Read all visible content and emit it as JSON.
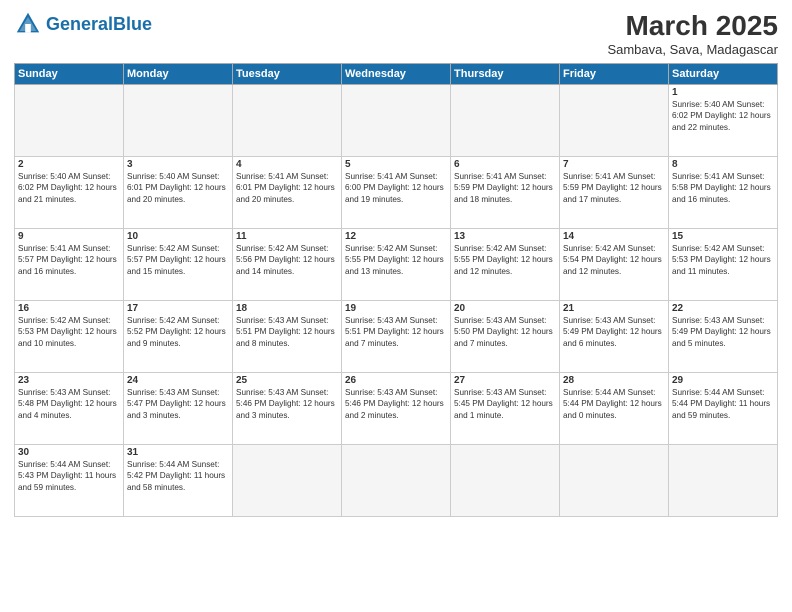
{
  "header": {
    "logo_general": "General",
    "logo_blue": "Blue",
    "month_title": "March 2025",
    "subtitle": "Sambava, Sava, Madagascar"
  },
  "weekdays": [
    "Sunday",
    "Monday",
    "Tuesday",
    "Wednesday",
    "Thursday",
    "Friday",
    "Saturday"
  ],
  "weeks": [
    [
      {
        "day": "",
        "info": ""
      },
      {
        "day": "",
        "info": ""
      },
      {
        "day": "",
        "info": ""
      },
      {
        "day": "",
        "info": ""
      },
      {
        "day": "",
        "info": ""
      },
      {
        "day": "",
        "info": ""
      },
      {
        "day": "1",
        "info": "Sunrise: 5:40 AM\nSunset: 6:02 PM\nDaylight: 12 hours and 22 minutes."
      }
    ],
    [
      {
        "day": "2",
        "info": "Sunrise: 5:40 AM\nSunset: 6:02 PM\nDaylight: 12 hours and 21 minutes."
      },
      {
        "day": "3",
        "info": "Sunrise: 5:40 AM\nSunset: 6:01 PM\nDaylight: 12 hours and 20 minutes."
      },
      {
        "day": "4",
        "info": "Sunrise: 5:41 AM\nSunset: 6:01 PM\nDaylight: 12 hours and 20 minutes."
      },
      {
        "day": "5",
        "info": "Sunrise: 5:41 AM\nSunset: 6:00 PM\nDaylight: 12 hours and 19 minutes."
      },
      {
        "day": "6",
        "info": "Sunrise: 5:41 AM\nSunset: 5:59 PM\nDaylight: 12 hours and 18 minutes."
      },
      {
        "day": "7",
        "info": "Sunrise: 5:41 AM\nSunset: 5:59 PM\nDaylight: 12 hours and 17 minutes."
      },
      {
        "day": "8",
        "info": "Sunrise: 5:41 AM\nSunset: 5:58 PM\nDaylight: 12 hours and 16 minutes."
      }
    ],
    [
      {
        "day": "9",
        "info": "Sunrise: 5:41 AM\nSunset: 5:57 PM\nDaylight: 12 hours and 16 minutes."
      },
      {
        "day": "10",
        "info": "Sunrise: 5:42 AM\nSunset: 5:57 PM\nDaylight: 12 hours and 15 minutes."
      },
      {
        "day": "11",
        "info": "Sunrise: 5:42 AM\nSunset: 5:56 PM\nDaylight: 12 hours and 14 minutes."
      },
      {
        "day": "12",
        "info": "Sunrise: 5:42 AM\nSunset: 5:55 PM\nDaylight: 12 hours and 13 minutes."
      },
      {
        "day": "13",
        "info": "Sunrise: 5:42 AM\nSunset: 5:55 PM\nDaylight: 12 hours and 12 minutes."
      },
      {
        "day": "14",
        "info": "Sunrise: 5:42 AM\nSunset: 5:54 PM\nDaylight: 12 hours and 12 minutes."
      },
      {
        "day": "15",
        "info": "Sunrise: 5:42 AM\nSunset: 5:53 PM\nDaylight: 12 hours and 11 minutes."
      }
    ],
    [
      {
        "day": "16",
        "info": "Sunrise: 5:42 AM\nSunset: 5:53 PM\nDaylight: 12 hours and 10 minutes."
      },
      {
        "day": "17",
        "info": "Sunrise: 5:42 AM\nSunset: 5:52 PM\nDaylight: 12 hours and 9 minutes."
      },
      {
        "day": "18",
        "info": "Sunrise: 5:43 AM\nSunset: 5:51 PM\nDaylight: 12 hours and 8 minutes."
      },
      {
        "day": "19",
        "info": "Sunrise: 5:43 AM\nSunset: 5:51 PM\nDaylight: 12 hours and 7 minutes."
      },
      {
        "day": "20",
        "info": "Sunrise: 5:43 AM\nSunset: 5:50 PM\nDaylight: 12 hours and 7 minutes."
      },
      {
        "day": "21",
        "info": "Sunrise: 5:43 AM\nSunset: 5:49 PM\nDaylight: 12 hours and 6 minutes."
      },
      {
        "day": "22",
        "info": "Sunrise: 5:43 AM\nSunset: 5:49 PM\nDaylight: 12 hours and 5 minutes."
      }
    ],
    [
      {
        "day": "23",
        "info": "Sunrise: 5:43 AM\nSunset: 5:48 PM\nDaylight: 12 hours and 4 minutes."
      },
      {
        "day": "24",
        "info": "Sunrise: 5:43 AM\nSunset: 5:47 PM\nDaylight: 12 hours and 3 minutes."
      },
      {
        "day": "25",
        "info": "Sunrise: 5:43 AM\nSunset: 5:46 PM\nDaylight: 12 hours and 3 minutes."
      },
      {
        "day": "26",
        "info": "Sunrise: 5:43 AM\nSunset: 5:46 PM\nDaylight: 12 hours and 2 minutes."
      },
      {
        "day": "27",
        "info": "Sunrise: 5:43 AM\nSunset: 5:45 PM\nDaylight: 12 hours and 1 minute."
      },
      {
        "day": "28",
        "info": "Sunrise: 5:44 AM\nSunset: 5:44 PM\nDaylight: 12 hours and 0 minutes."
      },
      {
        "day": "29",
        "info": "Sunrise: 5:44 AM\nSunset: 5:44 PM\nDaylight: 11 hours and 59 minutes."
      }
    ],
    [
      {
        "day": "30",
        "info": "Sunrise: 5:44 AM\nSunset: 5:43 PM\nDaylight: 11 hours and 59 minutes."
      },
      {
        "day": "31",
        "info": "Sunrise: 5:44 AM\nSunset: 5:42 PM\nDaylight: 11 hours and 58 minutes."
      },
      {
        "day": "",
        "info": ""
      },
      {
        "day": "",
        "info": ""
      },
      {
        "day": "",
        "info": ""
      },
      {
        "day": "",
        "info": ""
      },
      {
        "day": "",
        "info": ""
      }
    ]
  ]
}
